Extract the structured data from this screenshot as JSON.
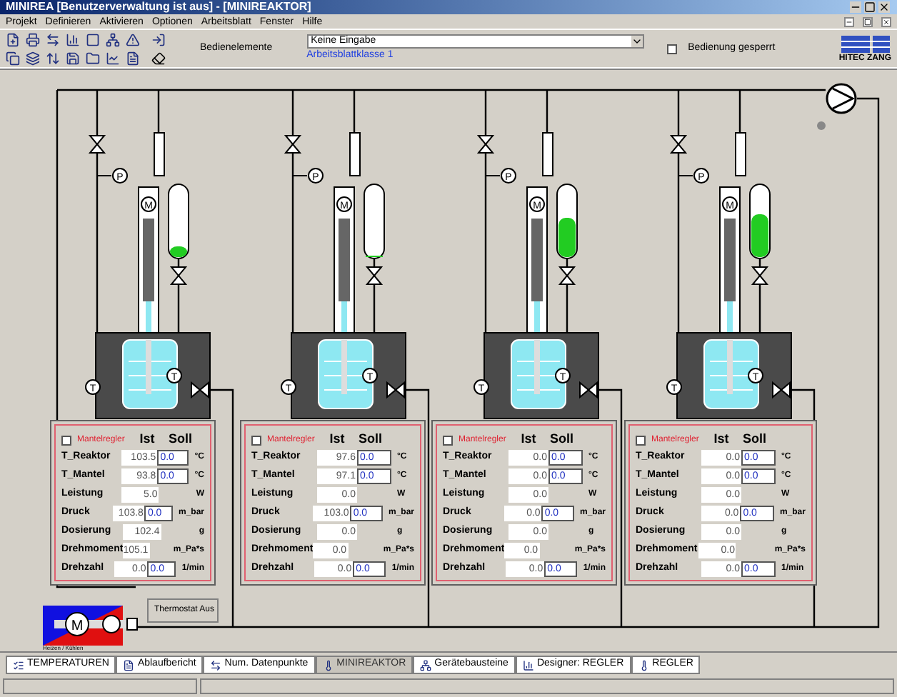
{
  "window": {
    "title": "MINIREA  [Benutzerverwaltung ist aus] - [MINIREAKTOR]"
  },
  "menu": [
    "Projekt",
    "Definieren",
    "Aktivieren",
    "Optionen",
    "Arbeitsblatt",
    "Fenster",
    "Hilfe"
  ],
  "toolbar": {
    "label": "Bedienelemente",
    "select_value": "Keine Eingabe",
    "link": "Arbeitsblattklasse 1",
    "lock": {
      "label": "Bedienung gesperrt",
      "checked": false
    },
    "logo": "HITEC ZANG"
  },
  "units": [
    {
      "burette": {
        "level": 0.15
      },
      "pressure": "P",
      "motor": "M",
      "temps": [
        "T",
        "T"
      ],
      "panel": {
        "mantel": {
          "label": "Mantelregler",
          "checked": false
        },
        "ist": "Ist",
        "soll": "Soll",
        "rows": [
          {
            "label": "T_Reaktor",
            "ist": "103.5",
            "soll": "0.0",
            "unit": "°C"
          },
          {
            "label": "T_Mantel",
            "ist": "93.8",
            "soll": "0.0",
            "unit": "°C"
          },
          {
            "label": "Leistung",
            "ist": "5.0",
            "unit": "W"
          },
          {
            "label": "Druck",
            "ist": "103.8",
            "soll": "0.0",
            "unit": "m_bar"
          },
          {
            "label": "Dosierung",
            "ist": "102.4",
            "unit": "g"
          },
          {
            "label": "Drehmoment",
            "ist": "105.1",
            "unit": "m_Pa*s"
          },
          {
            "label": "Drehzahl",
            "ist": "0.0",
            "soll": "0.0",
            "unit": "1/min"
          }
        ]
      }
    },
    {
      "burette": {
        "level": 0
      },
      "pressure": "P",
      "motor": "M",
      "temps": [
        "T",
        "T"
      ],
      "panel": {
        "mantel": {
          "label": "Mantelregler",
          "checked": false
        },
        "ist": "Ist",
        "soll": "Soll",
        "rows": [
          {
            "label": "T_Reaktor",
            "ist": "97.6",
            "soll": "0.0",
            "unit": "°C"
          },
          {
            "label": "T_Mantel",
            "ist": "97.1",
            "soll": "0.0",
            "unit": "°C"
          },
          {
            "label": "Leistung",
            "ist": "0.0",
            "unit": "W"
          },
          {
            "label": "Druck",
            "ist": "103.0",
            "soll": "0.0",
            "unit": "m_bar"
          },
          {
            "label": "Dosierung",
            "ist": "0.0",
            "unit": "g"
          },
          {
            "label": "Drehmoment",
            "ist": "0.0",
            "unit": "m_Pa*s"
          },
          {
            "label": "Drehzahl",
            "ist": "0.0",
            "soll": "0.0",
            "unit": "1/min"
          }
        ]
      }
    },
    {
      "burette": {
        "level": 0.55
      },
      "pressure": "P",
      "motor": "M",
      "temps": [
        "T",
        "T"
      ],
      "panel": {
        "mantel": {
          "label": "Mantelregler",
          "checked": false
        },
        "ist": "Ist",
        "soll": "Soll",
        "rows": [
          {
            "label": "T_Reaktor",
            "ist": "0.0",
            "soll": "0.0",
            "unit": "°C"
          },
          {
            "label": "T_Mantel",
            "ist": "0.0",
            "soll": "0.0",
            "unit": "°C"
          },
          {
            "label": "Leistung",
            "ist": "0.0",
            "unit": "W"
          },
          {
            "label": "Druck",
            "ist": "0.0",
            "soll": "0.0",
            "unit": "m_bar"
          },
          {
            "label": "Dosierung",
            "ist": "0.0",
            "unit": "g"
          },
          {
            "label": "Drehmoment",
            "ist": "0.0",
            "unit": "m_Pa*s"
          },
          {
            "label": "Drehzahl",
            "ist": "0.0",
            "soll": "0.0",
            "unit": "1/min"
          }
        ]
      }
    },
    {
      "burette": {
        "level": 0.6
      },
      "pressure": "P",
      "motor": "M",
      "temps": [
        "T",
        "T"
      ],
      "panel": {
        "mantel": {
          "label": "Mantelregler",
          "checked": false
        },
        "ist": "Ist",
        "soll": "Soll",
        "rows": [
          {
            "label": "T_Reaktor",
            "ist": "0.0",
            "soll": "0.0",
            "unit": "°C"
          },
          {
            "label": "T_Mantel",
            "ist": "0.0",
            "soll": "0.0",
            "unit": "°C"
          },
          {
            "label": "Leistung",
            "ist": "0.0",
            "unit": "W"
          },
          {
            "label": "Druck",
            "ist": "0.0",
            "soll": "0.0",
            "unit": "m_bar"
          },
          {
            "label": "Dosierung",
            "ist": "0.0",
            "unit": "g"
          },
          {
            "label": "Drehmoment",
            "ist": "0.0",
            "unit": "m_Pa*s"
          },
          {
            "label": "Drehzahl",
            "ist": "0.0",
            "soll": "0.0",
            "unit": "1/min"
          }
        ]
      }
    }
  ],
  "heater": {
    "motor": "M",
    "label": "Heizen / Kühlen",
    "thermostat": "Thermostat Aus"
  },
  "tabs": [
    {
      "label": "TEMPERATUREN",
      "selected": false
    },
    {
      "label": "Ablaufbericht",
      "selected": false
    },
    {
      "label": "Num. Datenpunkte",
      "selected": false
    },
    {
      "label": "MINIREAKTOR",
      "selected": true
    },
    {
      "label": "Gerätebausteine",
      "selected": false
    },
    {
      "label": "Designer: REGLER",
      "selected": false
    },
    {
      "label": "REGLER",
      "selected": false
    }
  ]
}
